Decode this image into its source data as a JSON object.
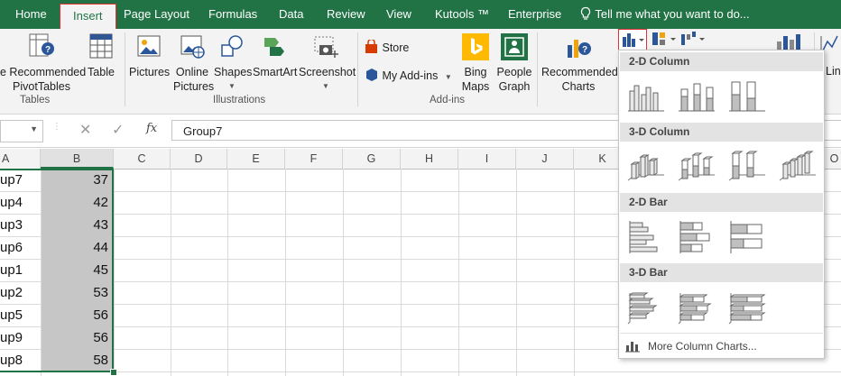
{
  "menu": {
    "tabs": [
      {
        "label": "Home"
      },
      {
        "label": "Insert"
      },
      {
        "label": "Page Layout"
      },
      {
        "label": "Formulas"
      },
      {
        "label": "Data"
      },
      {
        "label": "Review"
      },
      {
        "label": "View"
      },
      {
        "label": "Kutools ™"
      },
      {
        "label": "Enterprise"
      }
    ],
    "tell_me": "Tell me what you want to do..."
  },
  "ribbon": {
    "tables": {
      "recommended_line1": "e Recommended",
      "recommended_line2": "PivotTables",
      "table": "Table",
      "group": "Tables"
    },
    "illustrations": {
      "pictures": "Pictures",
      "online_line1": "Online",
      "online_line2": "Pictures",
      "shapes": "Shapes",
      "smartart": "SmartArt",
      "screenshot": "Screenshot",
      "group": "Illustrations"
    },
    "addins": {
      "store": "Store",
      "my_addins": "My Add-ins",
      "bing_line1": "Bing",
      "bing_line2": "Maps",
      "people_line1": "People",
      "people_line2": "Graph",
      "group": "Add-ins"
    },
    "charts": {
      "recommended_line1": "Recommended",
      "recommended_line2": "Charts",
      "lines_partial": "Lin"
    }
  },
  "formula_bar": {
    "formula": "Group7",
    "fx": "fx"
  },
  "grid": {
    "columns": [
      "A",
      "B",
      "C",
      "D",
      "E",
      "F",
      "G",
      "H",
      "I",
      "J",
      "K",
      "O"
    ],
    "rows": [
      {
        "a": "up7",
        "b": "37"
      },
      {
        "a": "up4",
        "b": "42"
      },
      {
        "a": "up3",
        "b": "43"
      },
      {
        "a": "up6",
        "b": "44"
      },
      {
        "a": "up1",
        "b": "45"
      },
      {
        "a": "up2",
        "b": "53"
      },
      {
        "a": "up5",
        "b": "56"
      },
      {
        "a": "up9",
        "b": "56"
      },
      {
        "a": "up8",
        "b": "58"
      }
    ]
  },
  "dropdown": {
    "sections": [
      {
        "title": "2-D Column"
      },
      {
        "title": "3-D Column"
      },
      {
        "title": "2-D Bar"
      },
      {
        "title": "3-D Bar"
      }
    ],
    "more": "More Column Charts..."
  },
  "colors": {
    "excel_green": "#217346",
    "selection_fill": "#c6c6c6",
    "selection_border": "#217346",
    "active_border": "#dd3333"
  }
}
